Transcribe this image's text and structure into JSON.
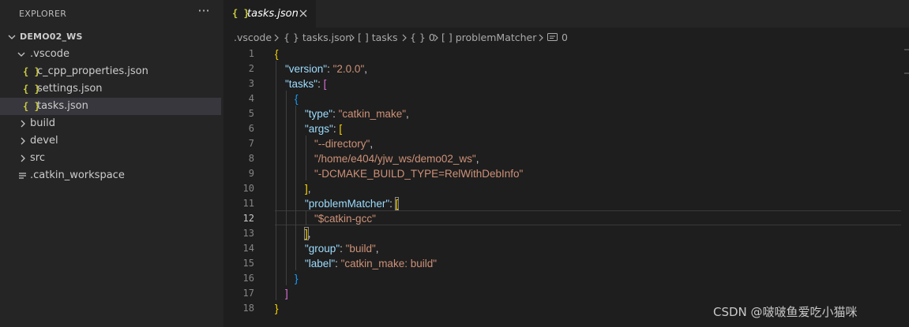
{
  "explorer": {
    "header": "EXPLORER",
    "more_label": "···",
    "root": "DEMO02_WS",
    "items": [
      {
        "label": ".vscode",
        "type": "folder-open"
      },
      {
        "label": "c_cpp_properties.json",
        "type": "json"
      },
      {
        "label": "settings.json",
        "type": "json"
      },
      {
        "label": "tasks.json",
        "type": "json",
        "selected": true
      },
      {
        "label": "build",
        "type": "folder"
      },
      {
        "label": "devel",
        "type": "folder"
      },
      {
        "label": "src",
        "type": "folder"
      },
      {
        "label": ".catkin_workspace",
        "type": "file"
      }
    ],
    "json_icon": "{ }"
  },
  "tab": {
    "label": "tasks.json",
    "icon": "{ }"
  },
  "breadcrumb": {
    "seg1": ".vscode",
    "seg2": "{ } tasks.json",
    "seg3": "[ ] tasks",
    "seg4": "{ } 0",
    "seg5": "[ ] problemMatcher",
    "seg6": "0"
  },
  "code": {
    "line_numbers": [
      "1",
      "2",
      "3",
      "4",
      "5",
      "6",
      "7",
      "8",
      "9",
      "10",
      "11",
      "12",
      "13",
      "14",
      "15",
      "16",
      "17",
      "18"
    ],
    "current_line": "12",
    "tokens": {
      "brace_open": "{",
      "brace_close": "}",
      "bracket_open": "[",
      "bracket_close": "]",
      "colon": ": ",
      "comma": ",",
      "k_version": "\"version\"",
      "s_version": "\"2.0.0\"",
      "k_tasks": "\"tasks\"",
      "k_type": "\"type\"",
      "s_type": "\"catkin_make\"",
      "k_args": "\"args\"",
      "s_arg1": "\"--directory\"",
      "s_arg2": "\"/home/e404/yjw_ws/demo02_ws\"",
      "s_arg3": "\"-DCMAKE_BUILD_TYPE=RelWithDebInfo\"",
      "k_problem": "\"problemMatcher\"",
      "s_problem": "\"$catkin-gcc\"",
      "k_group": "\"group\"",
      "s_group": "\"build\"",
      "k_label": "\"label\"",
      "s_label": "\"catkin_make: build\""
    }
  },
  "watermark": "CSDN @啵啵鱼爱吃小猫咪",
  "colors": {
    "key": "#9cdcfe",
    "string": "#ce9178",
    "bracket1": "#ffd700",
    "bracket2": "#da70d6",
    "bracket3": "#179fff"
  }
}
